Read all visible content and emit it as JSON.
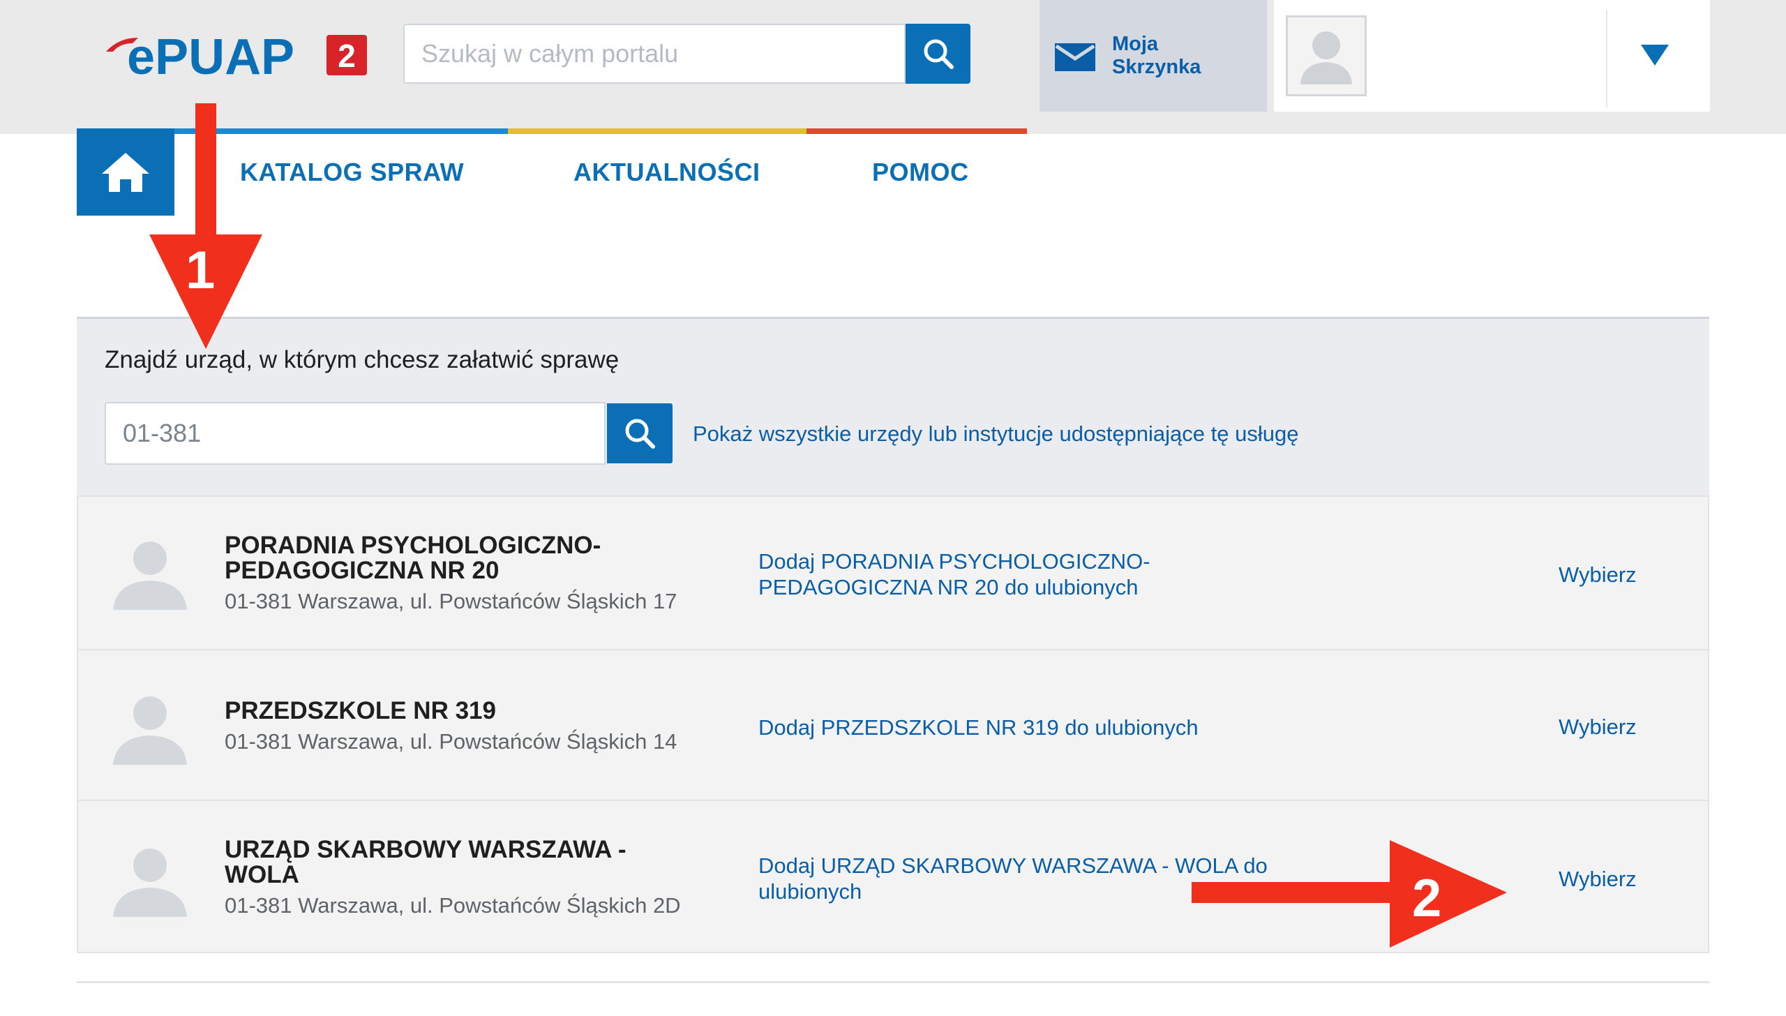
{
  "header": {
    "logo_text": "ePUAP",
    "logo_badge": "2",
    "search_placeholder": "Szukaj w całym portalu",
    "mailbox_line1": "Moja",
    "mailbox_line2": "Skrzynka"
  },
  "nav": {
    "items": [
      {
        "label": "KATALOG SPRAW"
      },
      {
        "label": "AKTUALNOŚCI"
      },
      {
        "label": "POMOC"
      }
    ]
  },
  "finder": {
    "title": "Znajdź urząd, w którym chcesz załatwić sprawę",
    "postal_code_value": "01-381",
    "show_all_link": "Pokaż wszystkie urzędy lub instytucje udostępniające tę usługę"
  },
  "results": [
    {
      "name": "PORADNIA PSYCHOLOGICZNO-PEDAGOGICZNA NR 20",
      "address": "01-381 Warszawa, ul. Powstańców Śląskich 17",
      "favorite": "Dodaj PORADNIA PSYCHOLOGICZNO-PEDAGOGICZNA NR 20 do ulubionych",
      "select": "Wybierz"
    },
    {
      "name": "PRZEDSZKOLE NR 319",
      "address": "01-381 Warszawa, ul. Powstańców Śląskich 14",
      "favorite": "Dodaj PRZEDSZKOLE NR 319 do ulubionych",
      "select": "Wybierz"
    },
    {
      "name": "URZĄD SKARBOWY WARSZAWA - WOLA",
      "address": "01-381 Warszawa, ul. Powstańców Śląskich 2D",
      "favorite": "Dodaj URZĄD SKARBOWY WARSZAWA - WOLA do ulubionych",
      "select": "Wybierz"
    }
  ],
  "annotations": {
    "arrow1_label": "1",
    "arrow2_label": "2"
  },
  "colors": {
    "brand_blue": "#0a6fb4",
    "link_blue": "#0a5ea8",
    "logo_red": "#d8232a",
    "annotation_red": "#f0301d",
    "bar_blue": "#1e88d2",
    "bar_yellow": "#e8bd2c",
    "bar_red": "#e5462e"
  },
  "icons": [
    "search-icon",
    "mail-icon",
    "user-avatar-icon",
    "caret-down-icon",
    "home-icon",
    "office-avatar-icon"
  ]
}
